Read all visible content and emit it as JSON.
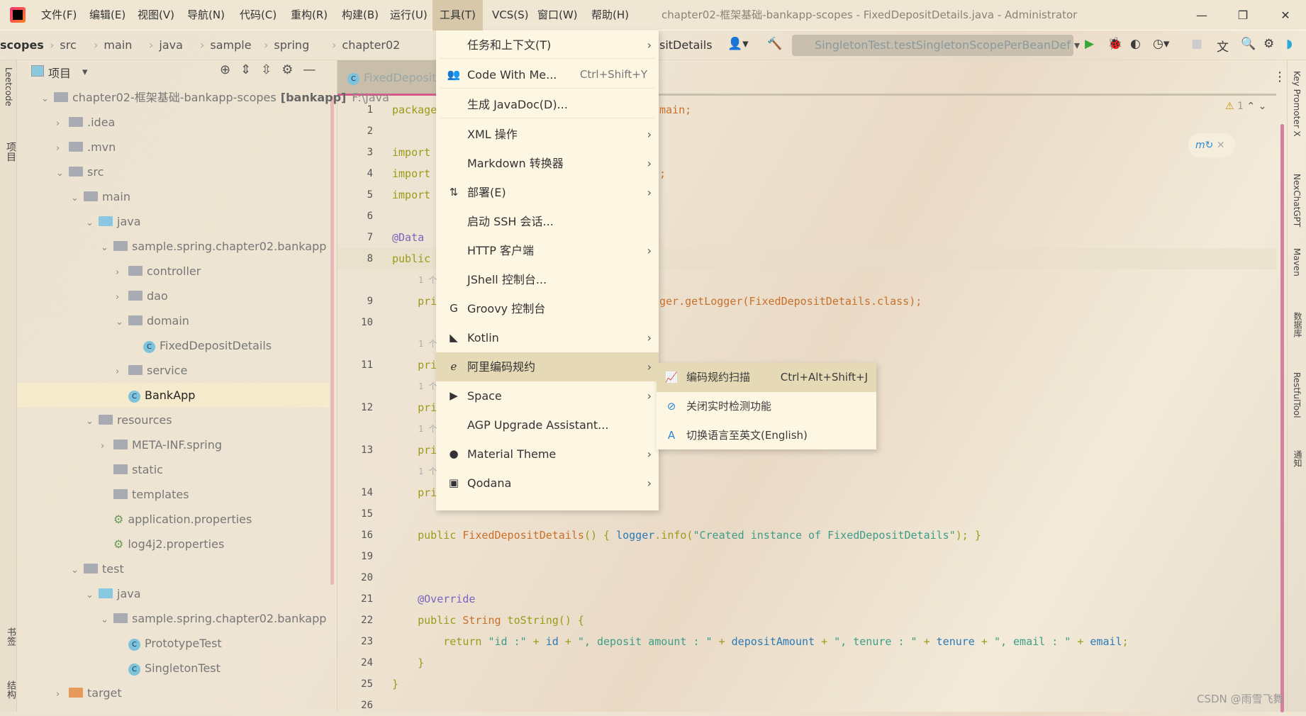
{
  "titlebar": {
    "menus": [
      "文件(F)",
      "编辑(E)",
      "视图(V)",
      "导航(N)",
      "代码(C)",
      "重构(R)",
      "构建(B)",
      "运行(U)",
      "工具(T)",
      "VCS(S)",
      "窗口(W)",
      "帮助(H)"
    ],
    "active_menu": "工具(T)",
    "window_title": "chapter02-框架基础-bankapp-scopes - FixedDepositDetails.java - Administrator",
    "controls": [
      "—",
      "❐",
      "✕"
    ]
  },
  "breadcrumb": [
    "scopes",
    "src",
    "main",
    "java",
    "sample",
    "spring",
    "chapter02"
  ],
  "breadcrumb_tail": "sitDetails",
  "toolbar": {
    "run_config": "SingletonTest.testSingletonScopePerBeanDef"
  },
  "left_strip": [
    "Leetcode",
    "项目",
    "书签",
    "结构"
  ],
  "right_strip": [
    "Key Promoter X",
    "NexChatGPT",
    "Maven",
    "数据库",
    "RestfulTool",
    "通知"
  ],
  "project": {
    "title": "项目",
    "tree": [
      {
        "depth": 0,
        "tw": "v",
        "icon": "module",
        "label": "chapter02-框架基础-bankapp-scopes",
        "bold": "[bankapp]",
        "extra": "F:\\Java"
      },
      {
        "depth": 1,
        "tw": ">",
        "icon": "folder",
        "label": ".idea"
      },
      {
        "depth": 1,
        "tw": ">",
        "icon": "folder",
        "label": ".mvn"
      },
      {
        "depth": 1,
        "tw": "v",
        "icon": "folder",
        "label": "src"
      },
      {
        "depth": 2,
        "tw": "v",
        "icon": "folder",
        "label": "main"
      },
      {
        "depth": 3,
        "tw": "v",
        "icon": "folder-blue",
        "label": "java"
      },
      {
        "depth": 4,
        "tw": "v",
        "icon": "package",
        "label": "sample.spring.chapter02.bankapp"
      },
      {
        "depth": 5,
        "tw": ">",
        "icon": "package",
        "label": "controller"
      },
      {
        "depth": 5,
        "tw": ">",
        "icon": "package",
        "label": "dao"
      },
      {
        "depth": 5,
        "tw": "v",
        "icon": "package",
        "label": "domain"
      },
      {
        "depth": 6,
        "tw": "",
        "icon": "class",
        "label": "FixedDepositDetails"
      },
      {
        "depth": 5,
        "tw": ">",
        "icon": "package",
        "label": "service"
      },
      {
        "depth": 5,
        "tw": "",
        "icon": "class",
        "label": "BankApp",
        "selected": true
      },
      {
        "depth": 3,
        "tw": "v",
        "icon": "folder",
        "label": "resources"
      },
      {
        "depth": 4,
        "tw": ">",
        "icon": "folder",
        "label": "META-INF.spring"
      },
      {
        "depth": 4,
        "tw": "",
        "icon": "folder",
        "label": "static"
      },
      {
        "depth": 4,
        "tw": "",
        "icon": "folder",
        "label": "templates"
      },
      {
        "depth": 4,
        "tw": "",
        "icon": "props",
        "label": "application.properties"
      },
      {
        "depth": 4,
        "tw": "",
        "icon": "props",
        "label": "log4j2.properties"
      },
      {
        "depth": 2,
        "tw": "v",
        "icon": "folder",
        "label": "test"
      },
      {
        "depth": 3,
        "tw": "v",
        "icon": "folder-blue",
        "label": "java"
      },
      {
        "depth": 4,
        "tw": "v",
        "icon": "package",
        "label": "sample.spring.chapter02.bankapp"
      },
      {
        "depth": 5,
        "tw": "",
        "icon": "class",
        "label": "PrototypeTest"
      },
      {
        "depth": 5,
        "tw": "",
        "icon": "class",
        "label": "SingletonTest"
      },
      {
        "depth": 1,
        "tw": ">",
        "icon": "folder-orange",
        "label": "target"
      }
    ]
  },
  "editor": {
    "tab": "FixedDepositDetails",
    "warnings": "1",
    "lines": [
      {
        "n": "1",
        "l": "package",
        "r": "main;"
      },
      {
        "n": "2",
        "l": ""
      },
      {
        "n": "3",
        "l": "import"
      },
      {
        "n": "4",
        "l": "import",
        "r": ";"
      },
      {
        "n": "5",
        "l": "import"
      },
      {
        "n": "6",
        "l": ""
      },
      {
        "n": "7",
        "l": "@Data",
        "cls": "ann"
      },
      {
        "n": "8",
        "l": "public"
      },
      {
        "n": "",
        "hint": "1 个"
      },
      {
        "n": "9",
        "l": "    pri",
        "r": "ger.getLogger(FixedDepositDetails.class);"
      },
      {
        "n": "10",
        "l": ""
      },
      {
        "n": "",
        "hint": "1 个"
      },
      {
        "n": "11",
        "l": "    pri"
      },
      {
        "n": "",
        "hint": "1 个"
      },
      {
        "n": "12",
        "l": "    pri"
      },
      {
        "n": "",
        "hint": "1 个"
      },
      {
        "n": "13",
        "l": "    pri"
      },
      {
        "n": "",
        "hint": "1 个"
      },
      {
        "n": "14",
        "l": "    pri"
      },
      {
        "n": "15",
        "l": ""
      },
      {
        "n": "16",
        "l": "    public FixedDepositDetails() { logger.info(\"Created instance of FixedDepositDetails\"); }"
      },
      {
        "n": "19",
        "l": ""
      },
      {
        "n": "20",
        "l": ""
      },
      {
        "n": "21",
        "l": "    @Override",
        "cls": "ann"
      },
      {
        "n": "22",
        "l": "    public String toString() {"
      },
      {
        "n": "23",
        "l": "        return \"id :\" + id + \", deposit amount : \" + depositAmount + \", tenure : \" + tenure + \", email : \" + email;"
      },
      {
        "n": "24",
        "l": "    }"
      },
      {
        "n": "25",
        "l": "}"
      },
      {
        "n": "26",
        "l": ""
      }
    ]
  },
  "tools_menu": [
    {
      "label": "任务和上下文(T)",
      "arrow": true
    },
    {
      "sep": true
    },
    {
      "icon": "people-icon",
      "glyph": "👥",
      "label": "Code With Me...",
      "shortcut": "Ctrl+Shift+Y"
    },
    {
      "sep": true
    },
    {
      "label": "生成 JavaDoc(D)..."
    },
    {
      "sep": true
    },
    {
      "label": "XML 操作",
      "arrow": true
    },
    {
      "label": "Markdown 转换器",
      "arrow": true
    },
    {
      "icon": "deploy-icon",
      "glyph": "⇅",
      "label": "部署(E)",
      "arrow": true
    },
    {
      "label": "启动 SSH 会话..."
    },
    {
      "label": "HTTP 客户端",
      "arrow": true
    },
    {
      "label": "JShell 控制台..."
    },
    {
      "icon": "groovy-icon",
      "glyph": "G",
      "label": "Groovy 控制台"
    },
    {
      "icon": "kotlin-icon",
      "glyph": "◣",
      "label": "Kotlin",
      "arrow": true
    },
    {
      "icon": "alibaba-icon",
      "glyph": "ℯ",
      "label": "阿里编码规约",
      "arrow": true,
      "highlighted": true
    },
    {
      "icon": "space-icon",
      "glyph": "▶",
      "label": "Space",
      "arrow": true
    },
    {
      "label": "AGP Upgrade Assistant..."
    },
    {
      "icon": "material-theme-icon",
      "glyph": "●",
      "label": "Material Theme",
      "arrow": true
    },
    {
      "icon": "qodana-icon",
      "glyph": "▣",
      "label": "Qodana",
      "arrow": true
    }
  ],
  "submenu": [
    {
      "icon": "scan-icon",
      "glyph": "📈",
      "label": "编码规约扫描",
      "shortcut": "Ctrl+Alt+Shift+J",
      "highlighted": true
    },
    {
      "icon": "disable-icon",
      "glyph": "⊘",
      "label": "关闭实时检测功能"
    },
    {
      "icon": "translate-icon",
      "glyph": "A",
      "label": "切换语言至英文(English)"
    }
  ],
  "watermark": "CSDN @雨雪飞舞",
  "colors": {
    "menu_bg": "#fdf6e3",
    "highlight": "#e6dab6",
    "scrollbar": "#d87fa0",
    "tab_underline": "#d55a8c"
  }
}
